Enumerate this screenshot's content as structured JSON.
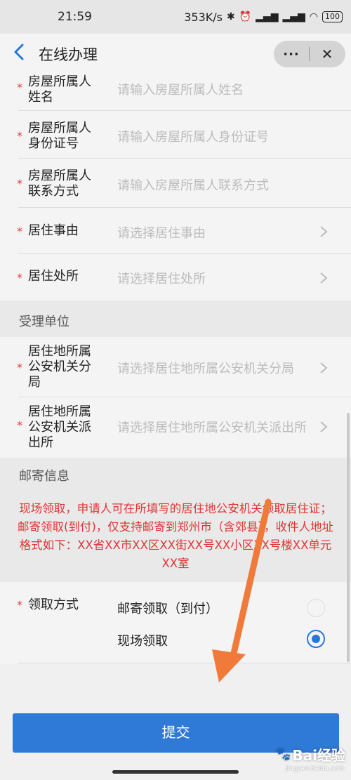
{
  "status_bar": {
    "time": "21:59",
    "speed": "353K/s",
    "battery": "100"
  },
  "nav": {
    "title": "在线办理",
    "more_label": "···",
    "close_label": "✕"
  },
  "form": {
    "owner_name": {
      "label": "房屋所属人姓名",
      "placeholder": "请输入房屋所属人姓名"
    },
    "owner_id": {
      "label": "房屋所属人身份证号",
      "placeholder": "请输入房屋所属人身份证号"
    },
    "owner_contact": {
      "label": "房屋所属人联系方式",
      "placeholder": "请输入房屋所属人联系方式"
    },
    "reason": {
      "label": "居住事由",
      "placeholder": "请选择居住事由"
    },
    "residence": {
      "label": "居住处所",
      "placeholder": "请选择居住处所"
    }
  },
  "section_accepting": {
    "title": "受理单位",
    "branch": {
      "label": "居住地所属公安机关分局",
      "placeholder": "请选择居住地所属公安机关分局"
    },
    "station": {
      "label": "居住地所属公安机关派出所",
      "placeholder": "请选择居住地所属公安机关派出所"
    }
  },
  "section_mailing": {
    "title": "邮寄信息",
    "notice": "现场领取，申请人可在所填写的居住地公安机关领取居住证；邮寄领取(到付)，仅支持邮寄到郑州市（含郊县），收件人地址格式如下：XX省XX市XX区XX街XX号XX小区XX号楼XX单元XX室"
  },
  "pickup": {
    "label": "领取方式",
    "options": [
      {
        "label": "邮寄领取（到付）",
        "checked": false
      },
      {
        "label": "现场领取",
        "checked": true
      }
    ]
  },
  "submit_label": "提交",
  "watermark": {
    "text": "Bai经验",
    "sub": "jingyan.baidu.com"
  },
  "colors": {
    "accent": "#2f79d7",
    "required": "#e23b3b",
    "notice": "#e03535",
    "arrow": "#f07a3a"
  }
}
